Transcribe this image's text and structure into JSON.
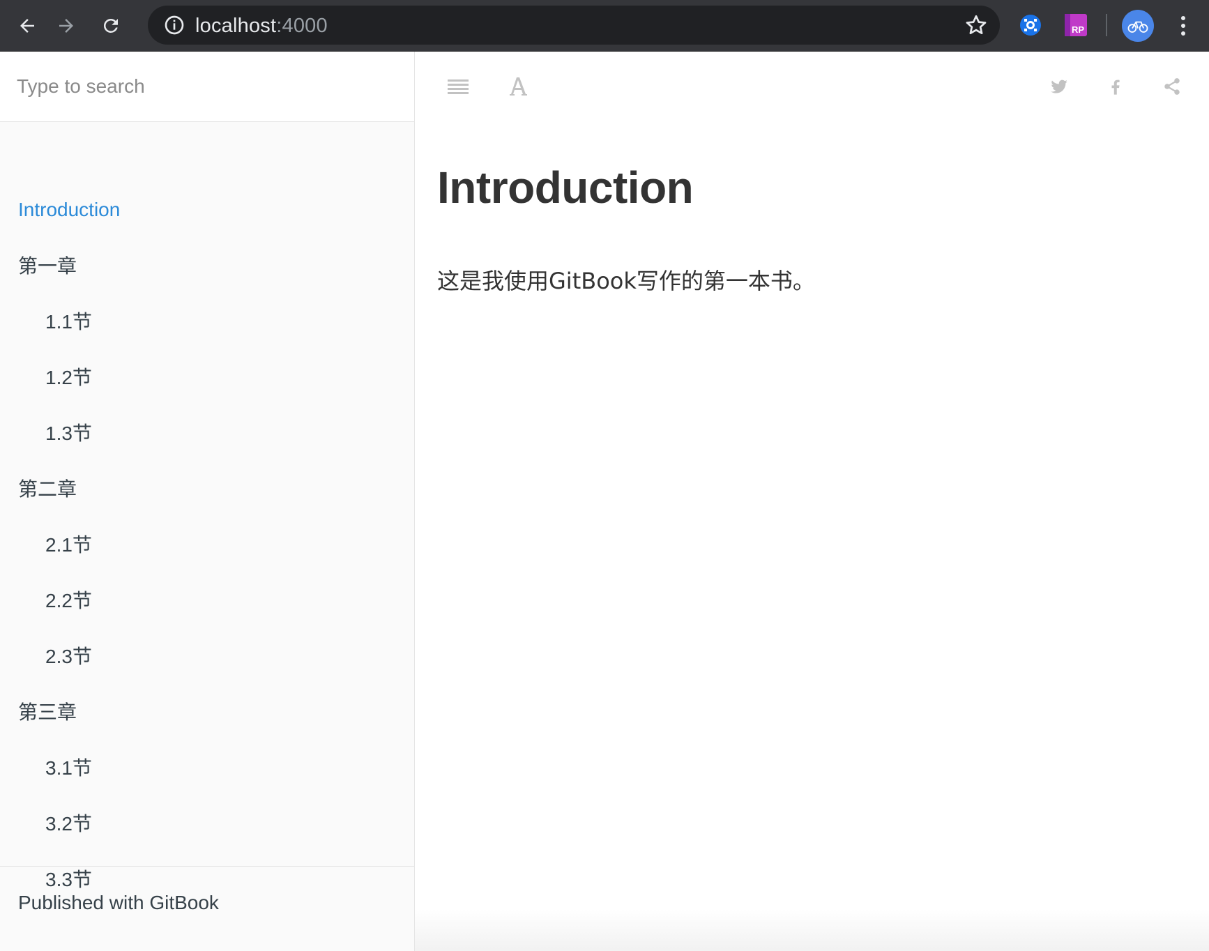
{
  "browser": {
    "url_host": "localhost",
    "url_port": ":4000",
    "back_icon": "arrow-left-icon",
    "forward_icon": "arrow-right-icon",
    "reload_icon": "reload-icon",
    "info_icon": "info-icon",
    "bookmark_icon": "star-icon",
    "extensions": [
      "extension-blue-icon",
      "extension-rp-icon"
    ],
    "extension_rp_text": "RP",
    "profile_icon": "bicycle-avatar-icon",
    "menu_icon": "kebab-menu-icon"
  },
  "sidebar": {
    "search_placeholder": "Type to search",
    "toc": [
      {
        "label": "Introduction",
        "level": 1,
        "active": true
      },
      {
        "label": "第一章",
        "level": 1,
        "active": false
      },
      {
        "label": "1.1节",
        "level": 2,
        "active": false
      },
      {
        "label": "1.2节",
        "level": 2,
        "active": false
      },
      {
        "label": "1.3节",
        "level": 2,
        "active": false
      },
      {
        "label": "第二章",
        "level": 1,
        "active": false
      },
      {
        "label": "2.1节",
        "level": 2,
        "active": false
      },
      {
        "label": "2.2节",
        "level": 2,
        "active": false
      },
      {
        "label": "2.3节",
        "level": 2,
        "active": false
      },
      {
        "label": "第三章",
        "level": 1,
        "active": false
      },
      {
        "label": "3.1节",
        "level": 2,
        "active": false
      },
      {
        "label": "3.2节",
        "level": 2,
        "active": false
      },
      {
        "label": "3.3节",
        "level": 2,
        "active": false
      }
    ],
    "footer_label": "Published with GitBook"
  },
  "toolbar": {
    "left_icons": [
      "menu-icon",
      "font-settings-icon"
    ],
    "right_icons": [
      "twitter-icon",
      "facebook-icon",
      "share-icon"
    ]
  },
  "page": {
    "title": "Introduction",
    "text": "这是我使用GitBook写作的第一本书。"
  },
  "colors": {
    "active_link": "#2b8ad8",
    "text": "#364149",
    "chrome_bg": "#35363a",
    "omnibox_bg": "#202124"
  }
}
